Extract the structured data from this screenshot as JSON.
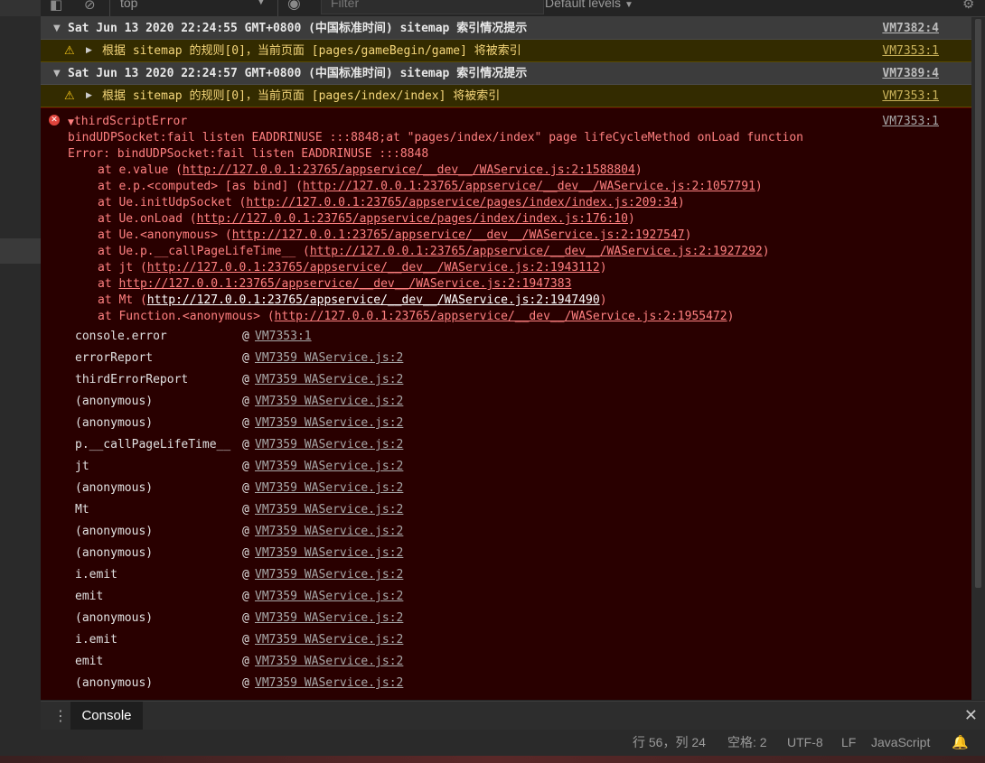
{
  "toolbar": {
    "context": "top",
    "filter_placeholder": "Filter",
    "levels": "Default levels"
  },
  "groups": [
    {
      "title": "Sat Jun 13 2020 22:24:55 GMT+0800 (中国标准时间) sitemap 索引情况提示",
      "source": "VM7382:4",
      "warning": "根据 sitemap 的规则[0]，当前页面 [pages/gameBegin/game] 将被索引",
      "warning_source": "VM7353:1"
    },
    {
      "title": "Sat Jun 13 2020 22:24:57 GMT+0800 (中国标准时间) sitemap 索引情况提示",
      "source": "VM7389:4",
      "warning": "根据 sitemap 的规则[0]，当前页面 [pages/index/index] 将被索引",
      "warning_source": "VM7353:1"
    }
  ],
  "error": {
    "title": "thirdScriptError",
    "source": "VM7353:1",
    "message1": "bindUDPSocket:fail listen EADDRINUSE :::8848;at \"pages/index/index\" page lifeCycleMethod onLoad function",
    "message2": "Error: bindUDPSocket:fail listen EADDRINUSE :::8848",
    "frames": [
      {
        "prefix": "at e.value (",
        "url": "http://127.0.0.1:23765/appservice/__dev__/WAService.js:2:1588804",
        "suffix": ")"
      },
      {
        "prefix": "at e.p.<computed> [as bind] (",
        "url": "http://127.0.0.1:23765/appservice/__dev__/WAService.js:2:1057791",
        "suffix": ")"
      },
      {
        "prefix": "at Ue.initUdpSocket (",
        "url": "http://127.0.0.1:23765/appservice/pages/index/index.js:209:34",
        "suffix": ")"
      },
      {
        "prefix": "at Ue.onLoad (",
        "url": "http://127.0.0.1:23765/appservice/pages/index/index.js:176:10",
        "suffix": ")"
      },
      {
        "prefix": "at Ue.<anonymous> (",
        "url": "http://127.0.0.1:23765/appservice/__dev__/WAService.js:2:1927547",
        "suffix": ")"
      },
      {
        "prefix": "at Ue.p.__callPageLifeTime__ (",
        "url": "http://127.0.0.1:23765/appservice/__dev__/WAService.js:2:1927292",
        "suffix": ")"
      },
      {
        "prefix": "at jt (",
        "url": "http://127.0.0.1:23765/appservice/__dev__/WAService.js:2:1943112",
        "suffix": ")"
      },
      {
        "prefix": "at ",
        "url": "http://127.0.0.1:23765/appservice/__dev__/WAService.js:2:1947383",
        "suffix": ""
      },
      {
        "prefix": "at Mt (",
        "url": "http://127.0.0.1:23765/appservice/__dev__/WAService.js:2:1947490",
        "suffix": ")"
      },
      {
        "prefix": "at Function.<anonymous> (",
        "url": "http://127.0.0.1:23765/appservice/__dev__/WAService.js:2:1955472",
        "suffix": ")"
      }
    ],
    "stack": [
      {
        "fn": "console.error",
        "loc": "VM7353:1"
      },
      {
        "fn": "errorReport",
        "loc": "VM7359 WAService.js:2"
      },
      {
        "fn": "thirdErrorReport",
        "loc": "VM7359 WAService.js:2"
      },
      {
        "fn": "(anonymous)",
        "loc": "VM7359 WAService.js:2"
      },
      {
        "fn": "(anonymous)",
        "loc": "VM7359 WAService.js:2"
      },
      {
        "fn": "p.__callPageLifeTime__",
        "loc": "VM7359 WAService.js:2"
      },
      {
        "fn": "jt",
        "loc": "VM7359 WAService.js:2"
      },
      {
        "fn": "(anonymous)",
        "loc": "VM7359 WAService.js:2"
      },
      {
        "fn": "Mt",
        "loc": "VM7359 WAService.js:2"
      },
      {
        "fn": "(anonymous)",
        "loc": "VM7359 WAService.js:2"
      },
      {
        "fn": "(anonymous)",
        "loc": "VM7359 WAService.js:2"
      },
      {
        "fn": "i.emit",
        "loc": "VM7359 WAService.js:2"
      },
      {
        "fn": "emit",
        "loc": "VM7359 WAService.js:2"
      },
      {
        "fn": "(anonymous)",
        "loc": "VM7359 WAService.js:2"
      },
      {
        "fn": "i.emit",
        "loc": "VM7359 WAService.js:2"
      },
      {
        "fn": "emit",
        "loc": "VM7359 WAService.js:2"
      },
      {
        "fn": "(anonymous)",
        "loc": "VM7359 WAService.js:2"
      }
    ],
    "at_sign": "@"
  },
  "drawer": {
    "tab": "Console"
  },
  "statusbar": {
    "position": "行 56，列 24",
    "indent": "空格: 2",
    "encoding": "UTF-8",
    "eol": "LF",
    "language": "JavaScript"
  },
  "colors": {
    "error_bg": "#290000",
    "error_text": "#ff8080",
    "warn_bg": "#332b00",
    "warn_text": "#f5d67a"
  }
}
